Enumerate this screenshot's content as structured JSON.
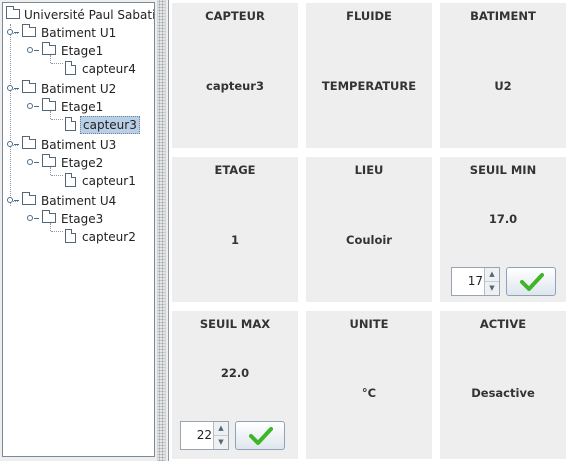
{
  "tree": {
    "root": "Université Paul Sabatier",
    "nodes": [
      {
        "level": 1,
        "type": "folder",
        "label": "Batiment U1"
      },
      {
        "level": 2,
        "type": "folder",
        "label": "Etage1"
      },
      {
        "level": 3,
        "type": "file",
        "label": "capteur4"
      },
      {
        "level": 1,
        "type": "folder",
        "label": "Batiment U2"
      },
      {
        "level": 2,
        "type": "folder",
        "label": "Etage1"
      },
      {
        "level": 3,
        "type": "file",
        "label": "capteur3",
        "selected": true
      },
      {
        "level": 1,
        "type": "folder",
        "label": "Batiment U3"
      },
      {
        "level": 2,
        "type": "folder",
        "label": "Etage2"
      },
      {
        "level": 3,
        "type": "file",
        "label": "capteur1"
      },
      {
        "level": 1,
        "type": "folder",
        "label": "Batiment U4"
      },
      {
        "level": 2,
        "type": "folder",
        "label": "Etage3"
      },
      {
        "level": 3,
        "type": "file",
        "label": "capteur2"
      }
    ]
  },
  "details": {
    "capteur": {
      "header": "CAPTEUR",
      "value": "capteur3"
    },
    "fluide": {
      "header": "FLUIDE",
      "value": "TEMPERATURE"
    },
    "batiment": {
      "header": "BATIMENT",
      "value": "U2"
    },
    "etage": {
      "header": "ETAGE",
      "value": "1"
    },
    "lieu": {
      "header": "LIEU",
      "value": "Couloir"
    },
    "seuil_min": {
      "header": "SEUIL MIN",
      "value": "17.0",
      "spinner_value": "17"
    },
    "seuil_max": {
      "header": "SEUIL MAX",
      "value": "22.0",
      "spinner_value": "22"
    },
    "unite": {
      "header": "UNITE",
      "value": "°C"
    },
    "active": {
      "header": "ACTIVE",
      "value": "Desactive"
    }
  },
  "icons": {
    "spinner_up": "arrow-up-icon",
    "spinner_down": "arrow-down-icon",
    "confirm": "checkmark-icon"
  },
  "colors": {
    "selection": "#b8cfe5",
    "checkmark": "#3fb528",
    "cell_background": "#eeeeee"
  }
}
